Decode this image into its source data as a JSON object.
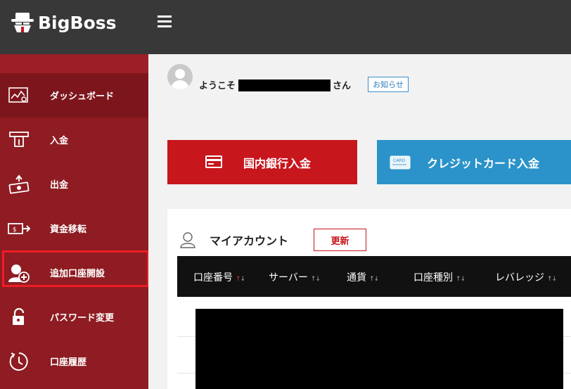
{
  "brand": {
    "name": "BigBoss",
    "accent": "#c8161d"
  },
  "header": {
    "menu_icon": "hamburger-icon"
  },
  "sidebar": {
    "items": [
      {
        "label": "ダッシュボード",
        "icon": "dashboard-chart-icon",
        "active": true
      },
      {
        "label": "入金",
        "icon": "atm-deposit-icon"
      },
      {
        "label": "出金",
        "icon": "cash-withdraw-icon"
      },
      {
        "label": "資金移転",
        "icon": "money-transfer-icon"
      },
      {
        "label": "追加口座開設",
        "icon": "add-account-icon",
        "highlighted": true
      },
      {
        "label": "パスワード変更",
        "icon": "unlock-icon"
      },
      {
        "label": "口座履歴",
        "icon": "history-clock-icon"
      }
    ]
  },
  "welcome": {
    "prefix": "ようこそ",
    "suffix": "さん",
    "notice_label": "お知らせ"
  },
  "deposit_buttons": {
    "bank_label": "国内銀行入金",
    "card_label": "クレジットカード入金",
    "card_icon_text": "CARD"
  },
  "account": {
    "title": "マイアカウント",
    "refresh_label": "更新",
    "columns": [
      "口座番号",
      "サーバー",
      "通貨",
      "口座種別",
      "レバレッジ"
    ]
  }
}
